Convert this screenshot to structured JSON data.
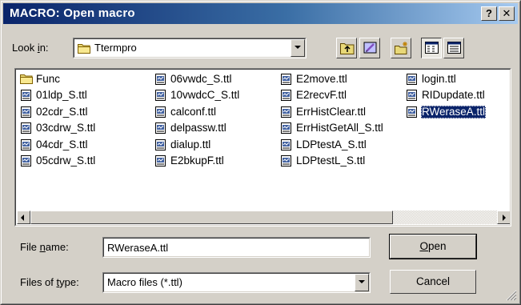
{
  "window": {
    "title": "MACRO: Open macro",
    "help_label": "?",
    "close_label": "✕"
  },
  "lookin": {
    "label_pre": "Look ",
    "label_accel": "i",
    "label_post": "n:",
    "value": "Ttermpro",
    "icon": "folder-icon"
  },
  "toolbar": [
    {
      "name": "up-one-level-button",
      "icon": "folder-up-icon"
    },
    {
      "name": "desktop-button",
      "icon": "desktop-icon"
    },
    {
      "name": "new-folder-button",
      "icon": "new-folder-icon"
    },
    {
      "name": "list-view-button",
      "icon": "list-view-icon"
    },
    {
      "name": "details-view-button",
      "icon": "details-view-icon"
    }
  ],
  "files": {
    "columns": [
      [
        {
          "name": "Func",
          "type": "folder"
        },
        {
          "name": "01ldp_S.ttl",
          "type": "ttl"
        },
        {
          "name": "02cdr_S.ttl",
          "type": "ttl"
        },
        {
          "name": "03cdrw_S.ttl",
          "type": "ttl"
        },
        {
          "name": "04cdr_S.ttl",
          "type": "ttl"
        },
        {
          "name": "05cdrw_S.ttl",
          "type": "ttl"
        }
      ],
      [
        {
          "name": "06vwdc_S.ttl",
          "type": "ttl"
        },
        {
          "name": "10vwdcC_S.ttl",
          "type": "ttl"
        },
        {
          "name": "calconf.ttl",
          "type": "ttl"
        },
        {
          "name": "delpassw.ttl",
          "type": "ttl"
        },
        {
          "name": "dialup.ttl",
          "type": "ttl"
        },
        {
          "name": "E2bkupF.ttl",
          "type": "ttl"
        }
      ],
      [
        {
          "name": "E2move.ttl",
          "type": "ttl"
        },
        {
          "name": "E2recvF.ttl",
          "type": "ttl"
        },
        {
          "name": "ErrHistClear.ttl",
          "type": "ttl"
        },
        {
          "name": "ErrHistGetAll_S.ttl",
          "type": "ttl"
        },
        {
          "name": "LDPtestA_S.ttl",
          "type": "ttl"
        },
        {
          "name": "LDPtestL_S.ttl",
          "type": "ttl"
        }
      ],
      [
        {
          "name": "login.ttl",
          "type": "ttl"
        },
        {
          "name": "RIDupdate.ttl",
          "type": "ttl"
        },
        {
          "name": "RWeraseA.ttl",
          "type": "ttl",
          "selected": true
        }
      ]
    ]
  },
  "filename": {
    "label_pre": "File ",
    "label_accel": "n",
    "label_post": "ame:",
    "value": "RWeraseA.ttl"
  },
  "filetype": {
    "label_pre": "Files of ",
    "label_accel": "t",
    "label_post": "ype:",
    "value": "Macro files (*.ttl)"
  },
  "buttons": {
    "open_accel": "O",
    "open_rest": "pen",
    "cancel": "Cancel"
  },
  "colors": {
    "title_start": "#0a246a",
    "title_end": "#a6caf0",
    "face": "#d4d0c8",
    "selection": "#0a246a"
  }
}
